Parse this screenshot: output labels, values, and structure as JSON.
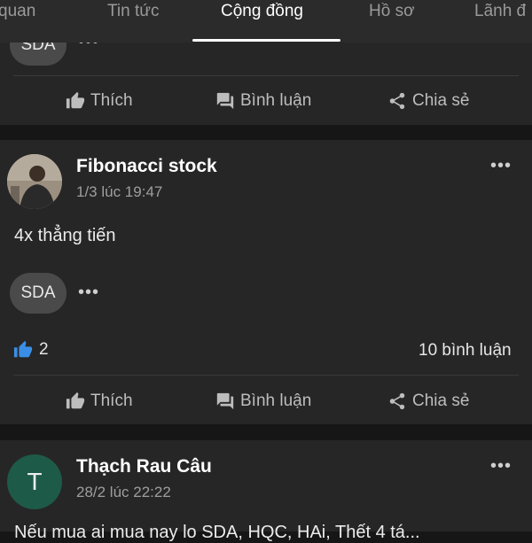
{
  "tabs": [
    {
      "label": "quan"
    },
    {
      "label": "Tin tức"
    },
    {
      "label": "Cộng đồng",
      "active": true
    },
    {
      "label": "Hồ sơ"
    },
    {
      "label": "Lãnh đ"
    }
  ],
  "actions": {
    "like": "Thích",
    "comment": "Bình luận",
    "share": "Chia sẻ"
  },
  "more_dots": "•••",
  "prev_post": {
    "stock": "SDA"
  },
  "posts": [
    {
      "author": "Fibonacci stock",
      "timestamp": "1/3 lúc 19:47",
      "text": "4x thẳng tiến",
      "stock": "SDA",
      "likes": "2",
      "comments": "10 bình luận"
    },
    {
      "author": "Thạch Rau Câu",
      "avatar_letter": "T",
      "avatar_color": "#1e5a48",
      "timestamp": "28/2 lúc 22:22",
      "text": "Nếu mua ai mua nay lo SDA, HQC, HAi, Thết 4 tá..."
    }
  ],
  "colors": {
    "background": "#161616",
    "card": "#262626",
    "like_blue": "#3a8ee6"
  }
}
